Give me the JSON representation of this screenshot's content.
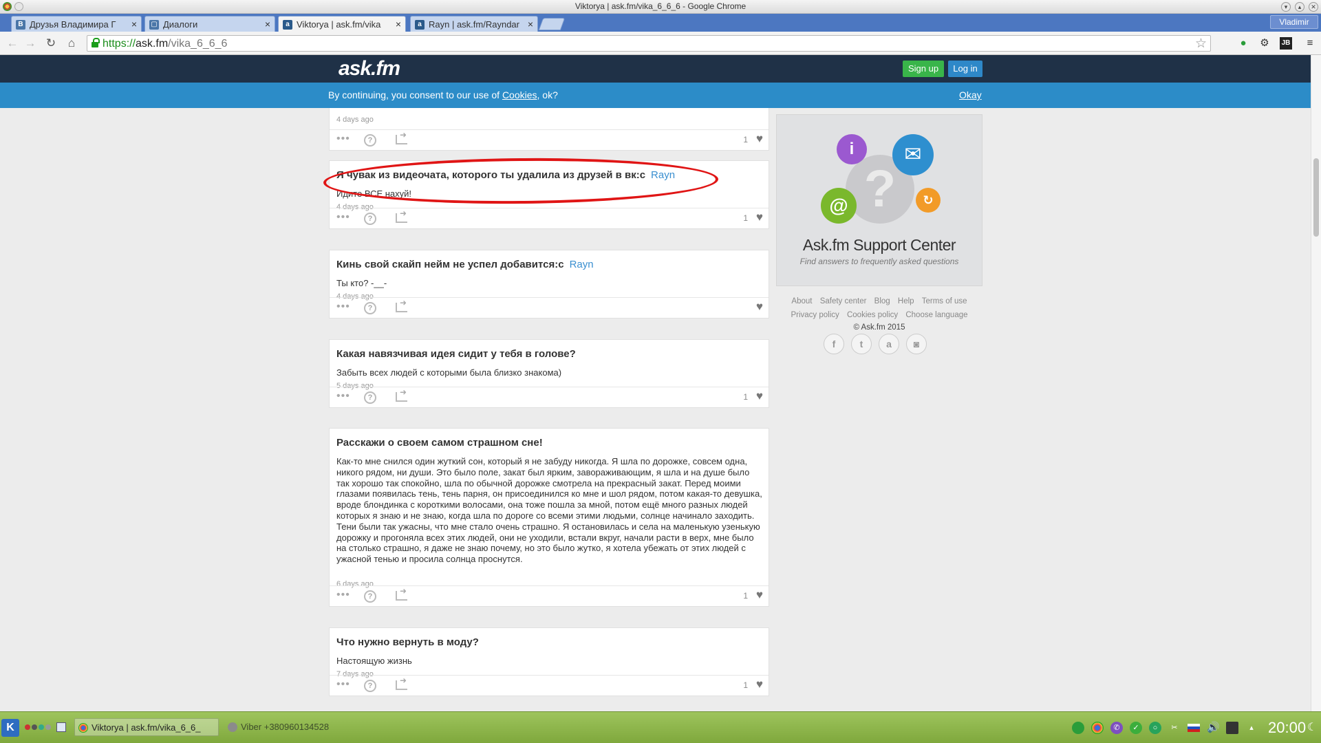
{
  "window": {
    "title": "Viktorya | ask.fm/vika_6_6_6 - Google Chrome",
    "user": "Vladimir"
  },
  "tabs": [
    {
      "label": "Друзья Владимира Г",
      "icon": "vk-icon",
      "active": false
    },
    {
      "label": "Диалоги",
      "icon": "vk-icon",
      "active": false
    },
    {
      "label": "Viktorya | ask.fm/vika",
      "icon": "askfm-icon",
      "active": true
    },
    {
      "label": "Rayn | ask.fm/Rayndar",
      "icon": "askfm-icon",
      "active": false
    }
  ],
  "toolbar": {
    "url_scheme": "https://",
    "url_host": "ask.fm",
    "url_path": "/vika_6_6_6"
  },
  "site": {
    "logo": "ask.fm",
    "signup": "Sign up",
    "login": "Log in"
  },
  "cookie": {
    "before": "By continuing, you consent to our use of ",
    "link": "Cookies",
    "after": ", ok?",
    "okay": "Okay"
  },
  "feed": {
    "top_time": "4 days ago",
    "top_likes": "1",
    "items": [
      {
        "question": "Я чувак из видеочата, которого ты удалила из друзей в вк:с",
        "author": "Rayn",
        "answer": "Идите ВСЕ нахуй!",
        "time": "4 days ago",
        "likes": "1"
      },
      {
        "question": "Кинь свой скайп нейм не успел добавится:с",
        "author": "Rayn",
        "answer": "Ты кто? -__-",
        "time": "4 days ago",
        "likes": ""
      },
      {
        "question": "Какая навязчивая идея сидит у тебя в голове?",
        "author": "",
        "answer": "Забыть всех людей с которыми была близко знакома)",
        "time": "5 days ago",
        "likes": "1"
      },
      {
        "question": "Расскажи о своем самом страшном сне!",
        "author": "",
        "answer": "Как-то мне снился один жуткий сон, который я не забуду никогда. Я шла по дорожке, совсем одна, никого рядом, ни души. Это было поле, закат был ярким, завораживающим, я шла и на душе было так хорошо так спокойно, шла по обычной дорожке смотрела на прекрасный закат. Перед моими глазами появилась тень, тень парня, он присоединился ко мне и шол рядом, потом какая-то девушка, вроде блондинка с короткими волосами, она тоже пошла за мной, потом ещё много разных людей которых я знаю и не знаю, когда шла по дороге со всеми этими людьми, солнце начинало заходить. Тени были так ужасны, что мне стало очень страшно. Я остановилась и села на маленькую узенькую дорожку и прогоняла всех этих людей, они не уходили, встали вкруг, начали расти в верх, мне было на столько страшно, я даже не знаю почему, но это было жутко, я хотела убежать от этих людей с ужасной тенью и просила солнца проснутся.",
        "time": "6 days ago",
        "likes": "1"
      },
      {
        "question": "Что нужно вернуть в моду?",
        "author": "",
        "answer": "Настоящую жизнь",
        "time": "7 days ago",
        "likes": "1"
      }
    ]
  },
  "sidebar": {
    "support_title": "Ask.fm Support Center",
    "support_sub": "Find answers to frequently asked questions",
    "links_row1": [
      "About",
      "Safety center",
      "Blog",
      "Help",
      "Terms of use"
    ],
    "links_row2": [
      "Privacy policy",
      "Cookies policy",
      "Choose language"
    ],
    "copyright": "© Ask.fm 2015",
    "socials": [
      "facebook-icon",
      "twitter-icon",
      "askfm-icon",
      "instagram-icon"
    ]
  },
  "taskbar": {
    "task1": "Viktorya | ask.fm/vika_6_6_",
    "task2": "Viber +380960134528",
    "clock": "20:00"
  },
  "colors": {
    "askfm_header": "#1f3147",
    "cookie_bar": "#2c8cc8",
    "signup": "#39b54a",
    "login": "#2e88c8",
    "author_link": "#3a8fd0",
    "highlight": "#e01515"
  }
}
